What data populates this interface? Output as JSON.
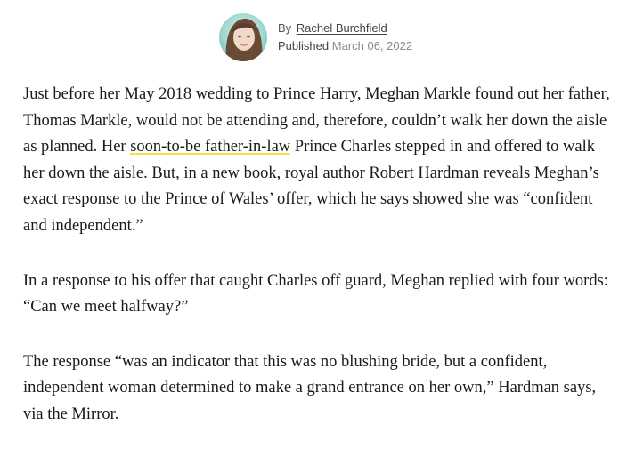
{
  "byline": {
    "by_prefix": "By",
    "author_name": "Rachel Burchfield",
    "published_label": "Published",
    "published_date": "March 06, 2022"
  },
  "article": {
    "p1": {
      "text_before": "Just before her May 2018 wedding to Prince Harry, Meghan Markle found out her father, Thomas Markle, would not be attending and, therefore, couldn’t walk her down the aisle as planned. Her ",
      "link_text": "soon-to-be father-in-law",
      "text_after": " Prince Charles stepped in and offered to walk her down the aisle. But, in a new book, royal author Robert Hardman reveals Meghan’s exact response to the Prince of Wales’ offer, which he says showed she was “confident and independent.”"
    },
    "p2": "In a response to his offer that caught Charles off guard, Meghan replied with four words: “Can we meet halfway?”",
    "p3": {
      "text_before": "The response “was an indicator that this was no blushing bride, but a confident, independent woman determined to make a grand entrance on her own,” Hardman says, via the",
      "link_text": " Mirror",
      "text_after": "."
    }
  },
  "colors": {
    "link_highlight": "#f4e14a",
    "body_text": "#1a1a1a",
    "meta_text": "#555555",
    "date_text": "#8a8a8a"
  },
  "icons": {
    "avatar": "author-avatar-photo"
  }
}
